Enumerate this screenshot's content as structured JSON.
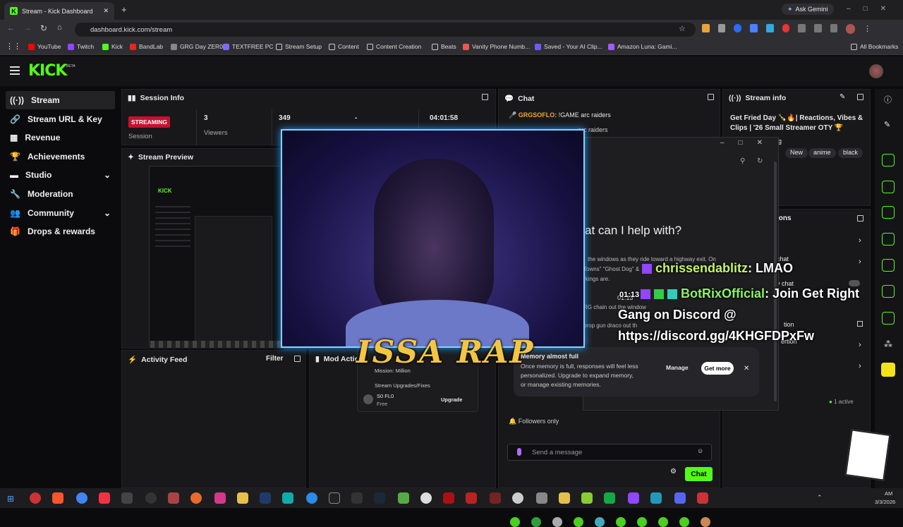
{
  "browser": {
    "tab_title": "Stream - Kick Dashboard",
    "url": "dashboard.kick.com/stream",
    "ask_gemini": "Ask Gemini",
    "all_bookmarks": "All Bookmarks",
    "bookmarks": [
      "YouTube",
      "Twitch",
      "Kick",
      "BandLab",
      "GRG Day ZER0",
      "TEXTFREE PC",
      "Stream Setup",
      "Content",
      "Content Creation",
      "Beats",
      "Vanity Phone Numb...",
      "Saved - Your AI Clip...",
      "Amazon Luna: Gami..."
    ]
  },
  "sidebar": {
    "items": [
      {
        "label": "Stream"
      },
      {
        "label": "Stream URL & Key"
      },
      {
        "label": "Revenue"
      },
      {
        "label": "Achievements"
      },
      {
        "label": "Studio"
      },
      {
        "label": "Moderation"
      },
      {
        "label": "Community"
      },
      {
        "label": "Drops & rewards"
      }
    ]
  },
  "session": {
    "title": "Session Info",
    "status": "STREAMING",
    "session_label": "Session",
    "viewers_value": "3",
    "viewers_label": "Viewers",
    "followers_value": "349",
    "dash": "-",
    "duration": "04:01:58"
  },
  "preview": {
    "title": "Stream Preview"
  },
  "activity": {
    "title": "Activity Feed",
    "filter": "Filter"
  },
  "mod": {
    "title": "Mod Actio"
  },
  "chat": {
    "title": "Chat",
    "msg1_user": "GRGSOFLO:",
    "msg1_text": " !GAME arc raiders",
    "msg2_partial": "arc raiders",
    "followers_only": "Followers only",
    "placeholder": "Send a message",
    "send": "Chat"
  },
  "stream_info": {
    "title": "Stream info",
    "text": "Get Fried Day 🍾🔥| Reactions, Vibes & Clips | '26 Small Streamer OTY 🏆",
    "setting_partial": "tting",
    "tags": [
      "New",
      "anime",
      "black"
    ],
    "ions": "ions",
    "chat": "chat",
    "ychat": "y chat",
    "tion": "tion",
    "ertion": "ertion",
    "active": "1 active"
  },
  "gemini": {
    "headline": "at can I help with?",
    "line1": "the windows as they ride toward a highway exit. On",
    "line2": "Towns\" \"Ghost Dog\" &",
    "line3": "rkings are.",
    "time": "01:13",
    "line4": "RG chain out the window",
    "line5": "prop gun draco out th",
    "memory_title": "Memory almost full",
    "memory_text1": "Once memory is full, responses will feel less",
    "memory_text2": "personalized. Upgrade to expand memory,",
    "memory_text3": "or manage existing memories.",
    "manage": "Manage",
    "get_more": "Get more"
  },
  "overlay": {
    "user1": "chrissendablitz",
    "msg1": ": LMAO",
    "user2": "BotRixOfficial",
    "msg2": ": Join Get Right",
    "msg3": "Gang on Discord @",
    "msg4": "https://discord.gg/4KHGFDPxFw",
    "brand": "ISSA RAP"
  },
  "popup": {
    "line1": "Mission: Million",
    "line2": "Stream Upgrades/Fixes",
    "user": "S0 FL0",
    "plan": "Free",
    "upgrade": "Upgrade"
  },
  "taskbar": {
    "date": "3/3/2026",
    "ampm": "AM"
  }
}
